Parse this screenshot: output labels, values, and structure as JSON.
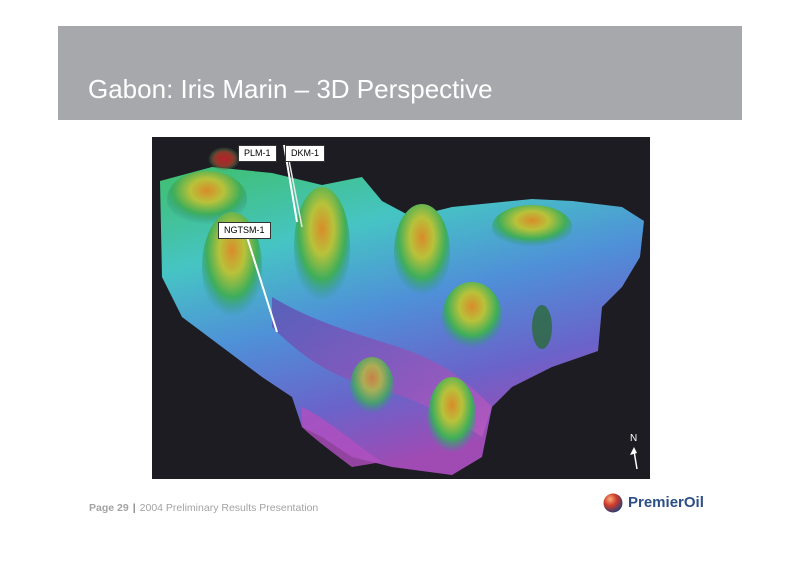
{
  "slide": {
    "title": "Gabon: Iris Marin – 3D Perspective"
  },
  "figure": {
    "wells": {
      "plm": "PLM-1",
      "dkm": "DKM-1",
      "ngtsm": "NGTSM-1"
    },
    "north_label": "N"
  },
  "footer": {
    "page": "Page 29",
    "separator": "|",
    "presentation": "2004 Preliminary Results Presentation"
  },
  "logo": {
    "text": "PremierOil"
  }
}
